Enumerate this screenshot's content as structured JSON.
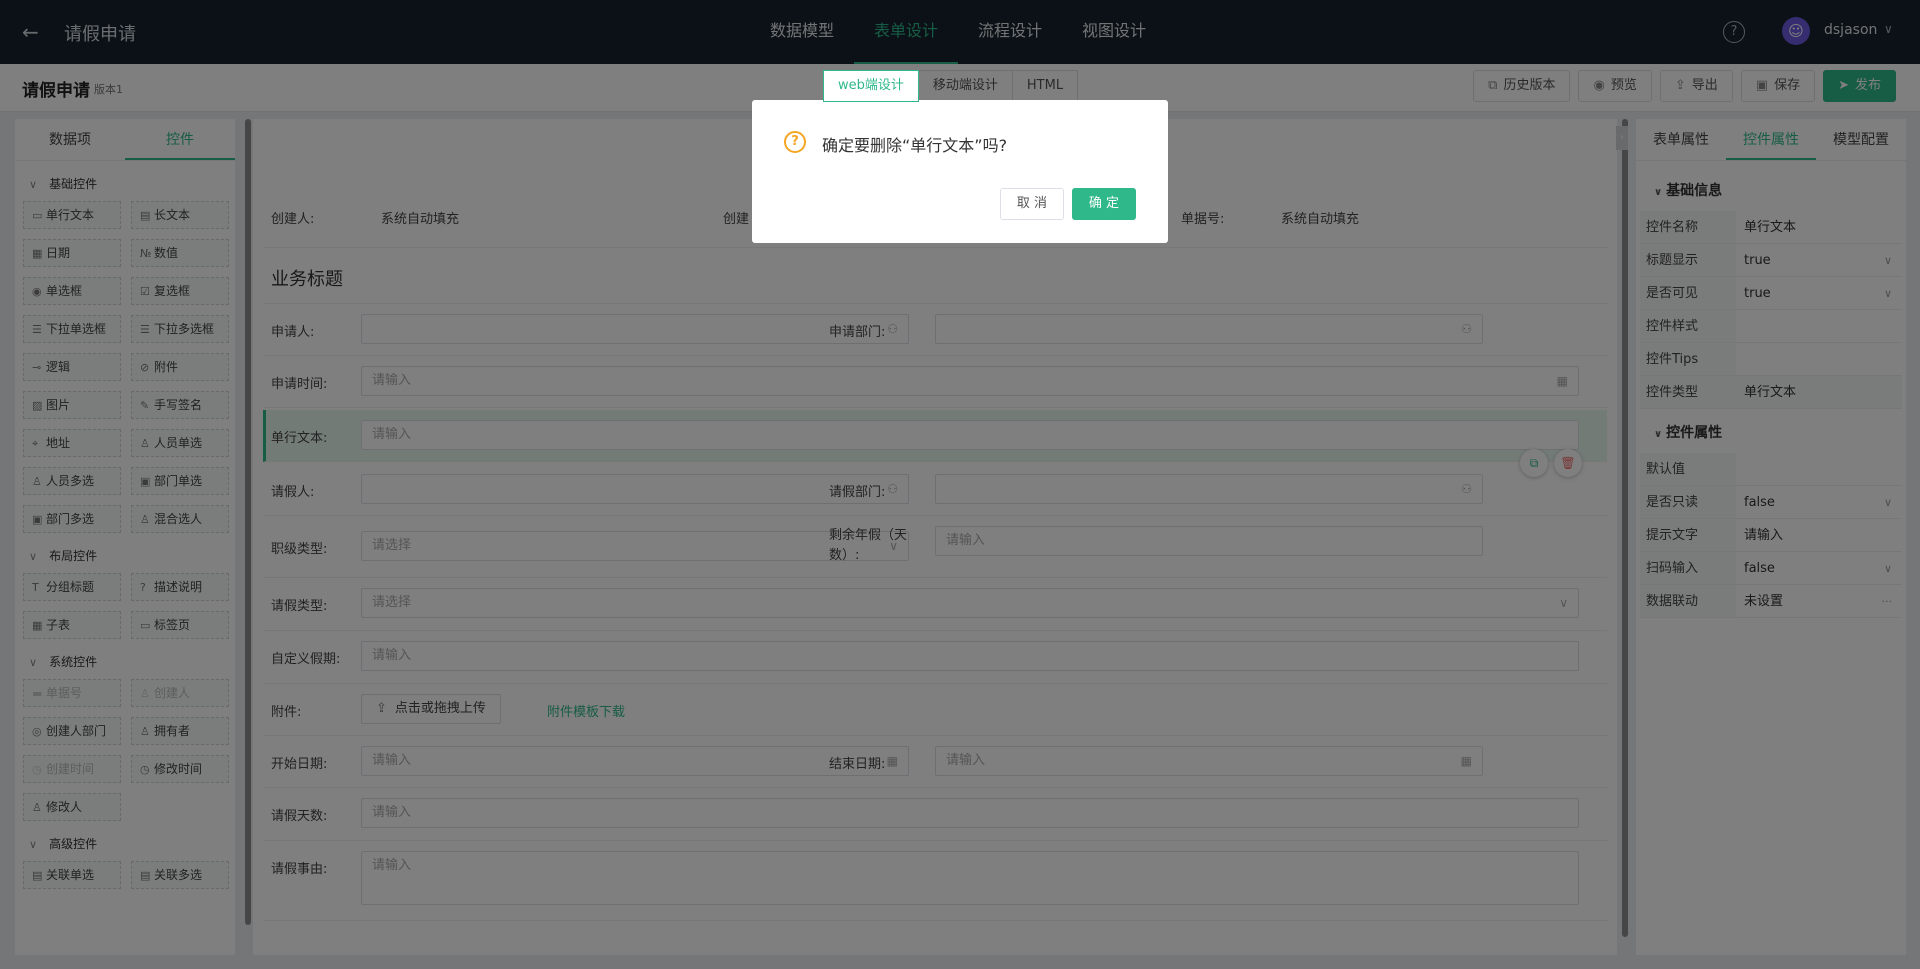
{
  "topbar": {
    "app_title": "请假申请",
    "nav": [
      "数据模型",
      "表单设计",
      "流程设计",
      "视图设计"
    ],
    "active_nav": "表单设计",
    "help": "?",
    "username": "dsjason"
  },
  "subbar": {
    "form_name": "请假申请",
    "version": "版本1",
    "design_tabs": [
      "web端设计",
      "移动端设计",
      "HTML"
    ],
    "actions": {
      "history": "历史版本",
      "preview": "预览",
      "export": "导出",
      "save": "保存",
      "publish": "发布"
    }
  },
  "left_panel": {
    "tabs": [
      "数据项",
      "控件"
    ],
    "groups": [
      {
        "title": "基础控件",
        "items": [
          {
            "label": "单行文本",
            "icon": "▭"
          },
          {
            "label": "长文本",
            "icon": "▤"
          },
          {
            "label": "日期",
            "icon": "▦"
          },
          {
            "label": "数值",
            "icon": "№"
          },
          {
            "label": "单选框",
            "icon": "◉"
          },
          {
            "label": "复选框",
            "icon": "☑"
          },
          {
            "label": "下拉单选框",
            "icon": "☰"
          },
          {
            "label": "下拉多选框",
            "icon": "☰"
          },
          {
            "label": "逻辑",
            "icon": "⊸"
          },
          {
            "label": "附件",
            "icon": "⊘"
          },
          {
            "label": "图片",
            "icon": "▨"
          },
          {
            "label": "手写签名",
            "icon": "✎"
          },
          {
            "label": "地址",
            "icon": "⌖"
          },
          {
            "label": "人员单选",
            "icon": "♙"
          },
          {
            "label": "人员多选",
            "icon": "♙"
          },
          {
            "label": "部门单选",
            "icon": "▣"
          },
          {
            "label": "部门多选",
            "icon": "▣"
          },
          {
            "label": "混合选人",
            "icon": "♙"
          }
        ]
      },
      {
        "title": "布局控件",
        "items": [
          {
            "label": "分组标题",
            "icon": "T"
          },
          {
            "label": "描述说明",
            "icon": "?"
          },
          {
            "label": "子表",
            "icon": "▦"
          },
          {
            "label": "标签页",
            "icon": "▭"
          }
        ]
      },
      {
        "title": "系统控件",
        "items": [
          {
            "label": "单据号",
            "icon": "▬",
            "disabled": true
          },
          {
            "label": "创建人",
            "icon": "♙",
            "disabled": true
          },
          {
            "label": "创建人部门",
            "icon": "◎"
          },
          {
            "label": "拥有者",
            "icon": "♙"
          },
          {
            "label": "创建时间",
            "icon": "◷",
            "disabled": true
          },
          {
            "label": "修改时间",
            "icon": "◷"
          },
          {
            "label": "修改人",
            "icon": "♙"
          }
        ]
      },
      {
        "title": "高级控件",
        "items": [
          {
            "label": "关联单选",
            "icon": "▤"
          },
          {
            "label": "关联多选",
            "icon": "▤"
          }
        ]
      }
    ]
  },
  "canvas": {
    "system_row": {
      "creator_label": "创建人:",
      "creator_value": "系统自动填充",
      "creator_dept_label": "创建",
      "doc_no_label": "单据号:",
      "doc_no_value": "系统自动填充"
    },
    "section_title": "业务标题",
    "applicant_label": "申请人:",
    "apply_dept_label": "申请部门:",
    "apply_time_label": "申请时间:",
    "single_text_label": "单行文本:",
    "leave_person_label": "请假人:",
    "leave_dept_label": "请假部门:",
    "rank_type_label": "职级类型:",
    "remaining_label": "剩余年假（天数）:",
    "leave_type_label": "请假类型:",
    "custom_holiday_label": "自定义假期:",
    "attachment_label": "附件:",
    "upload_button": "点击或拖拽上传",
    "template_download": "附件模板下载",
    "start_date_label": "开始日期:",
    "end_date_label": "结束日期:",
    "leave_days_label": "请假天数:",
    "leave_reason_label": "请假事由:",
    "placeholder_input": "请输入",
    "placeholder_select": "请选择"
  },
  "right_panel": {
    "tabs": [
      "表单属性",
      "控件属性",
      "模型配置"
    ],
    "basic_title": "基础信息",
    "basic_rows": [
      {
        "key": "控件名称",
        "value": "单行文本"
      },
      {
        "key": "标题显示",
        "value": "true",
        "dropdown": true
      },
      {
        "key": "是否可见",
        "value": "true",
        "dropdown": true
      },
      {
        "key": "控件样式",
        "value": ""
      },
      {
        "key": "控件Tips",
        "value": ""
      },
      {
        "key": "控件类型",
        "value": "单行文本",
        "gray": true
      }
    ],
    "ctrl_title": "控件属性",
    "ctrl_rows": [
      {
        "key": "默认值",
        "value": ""
      },
      {
        "key": "是否只读",
        "value": "false",
        "dropdown": true
      },
      {
        "key": "提示文字",
        "value": "请输入"
      },
      {
        "key": "扫码输入",
        "value": "false",
        "dropdown": true
      },
      {
        "key": "数据联动",
        "value": "未设置",
        "more": true
      }
    ]
  },
  "dialog": {
    "message": "确定要删除“单行文本”吗?",
    "cancel": "取 消",
    "confirm": "确 定"
  },
  "colors": {
    "accent": "#2fb889",
    "topbar": "#17232d",
    "warning": "#f5a623",
    "danger": "#f56c6c"
  }
}
